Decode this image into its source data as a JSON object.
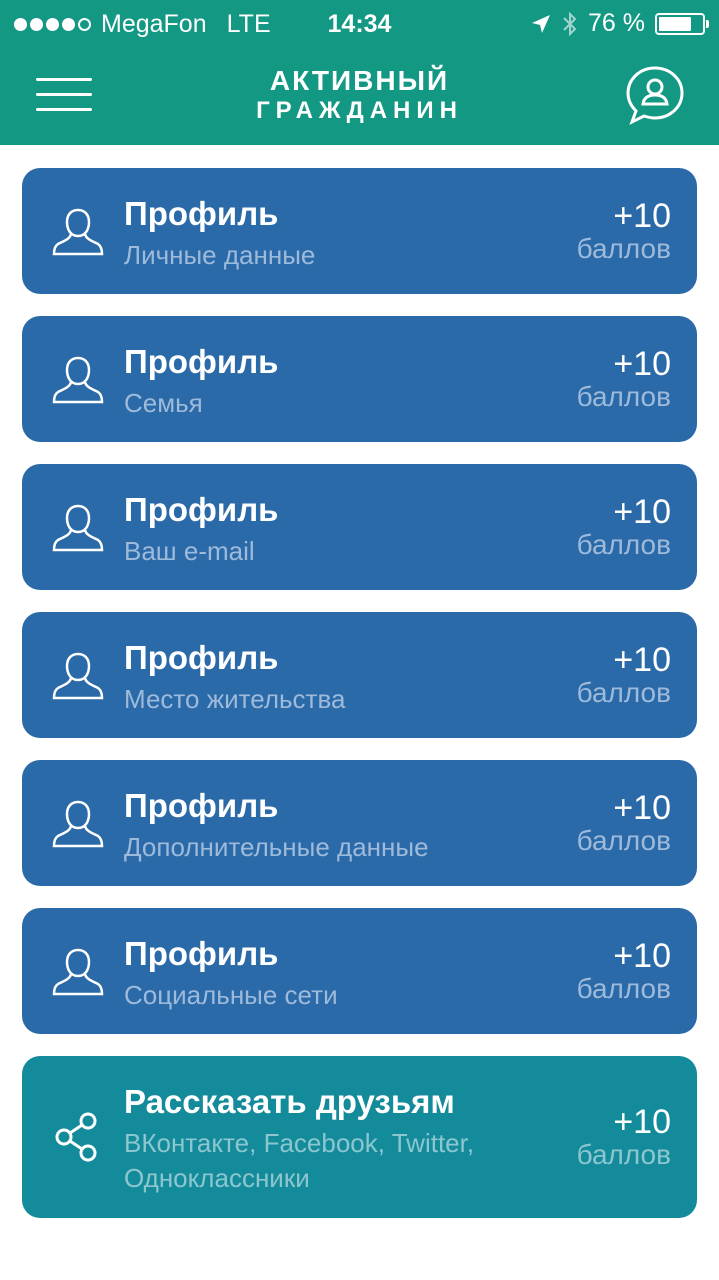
{
  "colors": {
    "header": "#129883",
    "profile_card": "#2B6AA8",
    "profile_sub": "#9EBADB",
    "share_card": "#148B9B",
    "share_sub": "#8CC6CF",
    "points_word_profile": "#9EBADB",
    "points_word_share": "#8CC6CF"
  },
  "status_bar": {
    "carrier": "MegaFon",
    "network": "LTE",
    "time": "14:34",
    "battery": "76 %",
    "battery_level": 0.76
  },
  "header": {
    "logo_line1": "АКТИВНЫЙ",
    "logo_line2": "ГРАЖДАНИН",
    "menu_icon": "hamburger-icon",
    "profile_icon": "profile-chat-icon"
  },
  "items": [
    {
      "title": "Профиль",
      "subtitle": "Личные данные",
      "points": "+10",
      "points_label": "баллов",
      "icon": "user-icon",
      "kind": "profile"
    },
    {
      "title": "Профиль",
      "subtitle": "Семья",
      "points": "+10",
      "points_label": "баллов",
      "icon": "user-icon",
      "kind": "profile"
    },
    {
      "title": "Профиль",
      "subtitle": "Ваш e-mail",
      "points": "+10",
      "points_label": "баллов",
      "icon": "user-icon",
      "kind": "profile"
    },
    {
      "title": "Профиль",
      "subtitle": "Место жительства",
      "points": "+10",
      "points_label": "баллов",
      "icon": "user-icon",
      "kind": "profile"
    },
    {
      "title": "Профиль",
      "subtitle": "Дополнительные данные",
      "points": "+10",
      "points_label": "баллов",
      "icon": "user-icon",
      "kind": "profile"
    },
    {
      "title": "Профиль",
      "subtitle": "Социальные сети",
      "points": "+10",
      "points_label": "баллов",
      "icon": "user-icon",
      "kind": "profile"
    },
    {
      "title": "Рассказать друзьям",
      "subtitle": "ВКонтакте, Facebook, Twitter, Одноклассники",
      "points": "+10",
      "points_label": "баллов",
      "icon": "share-icon",
      "kind": "share"
    }
  ]
}
